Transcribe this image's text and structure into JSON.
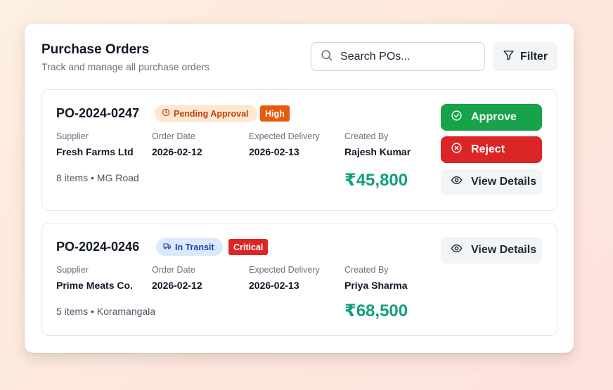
{
  "header": {
    "title": "Purchase Orders",
    "subtitle": "Track and manage all purchase orders",
    "search_placeholder": "Search POs...",
    "filter_label": "Filter"
  },
  "field_labels": {
    "supplier": "Supplier",
    "order_date": "Order Date",
    "expected_delivery": "Expected Delivery",
    "created_by": "Created By"
  },
  "orders": [
    {
      "id": "PO-2024-0247",
      "status": "Pending Approval",
      "status_icon": "clock-icon",
      "priority": "High",
      "supplier": "Fresh Farms Ltd",
      "order_date": "2026-02-12",
      "expected_delivery": "2026-02-13",
      "created_by": "Rajesh Kumar",
      "meta": "8 items • MG Road",
      "amount": "₹45,800",
      "actions": {
        "approve": "Approve",
        "reject": "Reject",
        "view": "View Details"
      }
    },
    {
      "id": "PO-2024-0246",
      "status": "In Transit",
      "status_icon": "truck-icon",
      "priority": "Critical",
      "supplier": "Prime Meats Co.",
      "order_date": "2026-02-12",
      "expected_delivery": "2026-02-13",
      "created_by": "Priya Sharma",
      "meta": "5 items • Koramangala",
      "amount": "₹68,500",
      "actions": {
        "view": "View Details"
      }
    }
  ],
  "colors": {
    "approve": "#16a34a",
    "reject": "#dc2626",
    "amount": "#0f9f7f",
    "priority_high": "#ea580c",
    "priority_critical": "#dc2626"
  }
}
